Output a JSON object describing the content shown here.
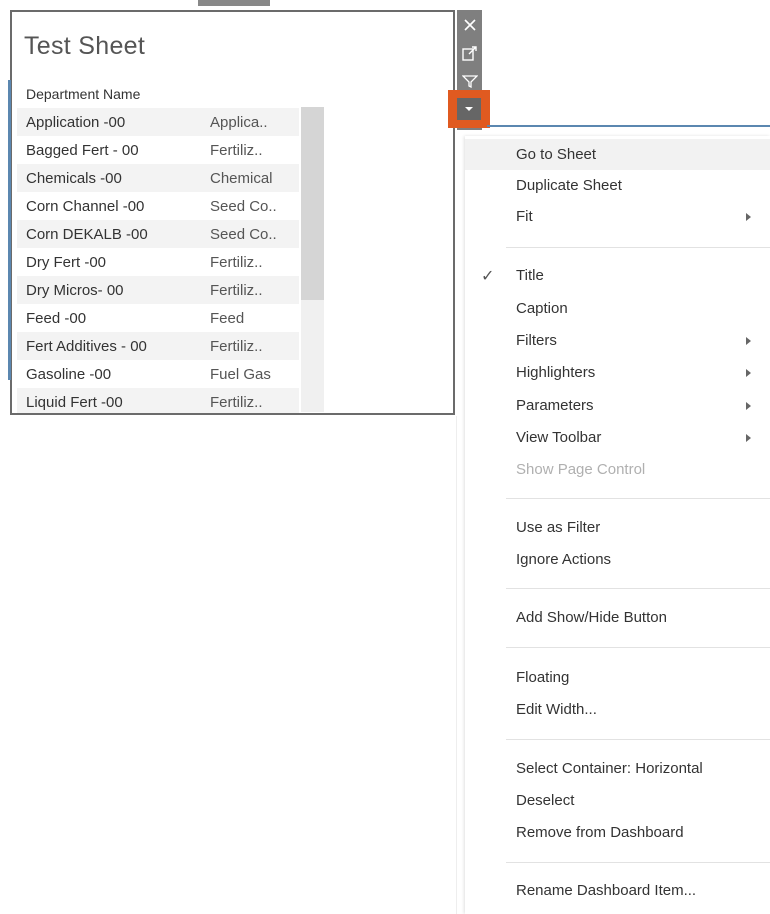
{
  "sheet": {
    "title": "Test Sheet",
    "column_header": "Department Name",
    "rows": [
      {
        "name": "Application -00",
        "category": "Applica.."
      },
      {
        "name": "Bagged Fert - 00",
        "category": "Fertiliz.."
      },
      {
        "name": "Chemicals -00",
        "category": "Chemical"
      },
      {
        "name": "Corn Channel -00",
        "category": "Seed Co.."
      },
      {
        "name": "Corn DEKALB -00",
        "category": "Seed Co.."
      },
      {
        "name": "Dry Fert -00",
        "category": "Fertiliz.."
      },
      {
        "name": "Dry Micros- 00",
        "category": "Fertiliz.."
      },
      {
        "name": "Feed -00",
        "category": "Feed"
      },
      {
        "name": "Fert Additives - 00",
        "category": "Fertiliz.."
      },
      {
        "name": "Gasoline -00",
        "category": "Fuel Gas"
      },
      {
        "name": "Liquid Fert -00",
        "category": "Fertiliz.."
      }
    ]
  },
  "toolbar": {
    "close_icon": "close-icon",
    "popout_icon": "popout-icon",
    "filter_icon": "filter-icon",
    "menu_icon": "dropdown-arrow-icon",
    "accent_color": "#e05a20"
  },
  "menu": {
    "go_to_sheet": "Go to Sheet",
    "duplicate_sheet": "Duplicate Sheet",
    "fit": "Fit",
    "title": "Title",
    "caption": "Caption",
    "filters": "Filters",
    "highlighters": "Highlighters",
    "parameters": "Parameters",
    "view_toolbar": "View Toolbar",
    "show_page_control": "Show Page Control",
    "use_as_filter": "Use as Filter",
    "ignore_actions": "Ignore Actions",
    "add_show_hide_button": "Add Show/Hide Button",
    "floating": "Floating",
    "edit_width": "Edit Width...",
    "select_container": "Select Container: Horizontal",
    "deselect": "Deselect",
    "remove_from_dashboard": "Remove from Dashboard",
    "rename_dashboard_item": "Rename Dashboard Item...",
    "title_checked": true
  }
}
